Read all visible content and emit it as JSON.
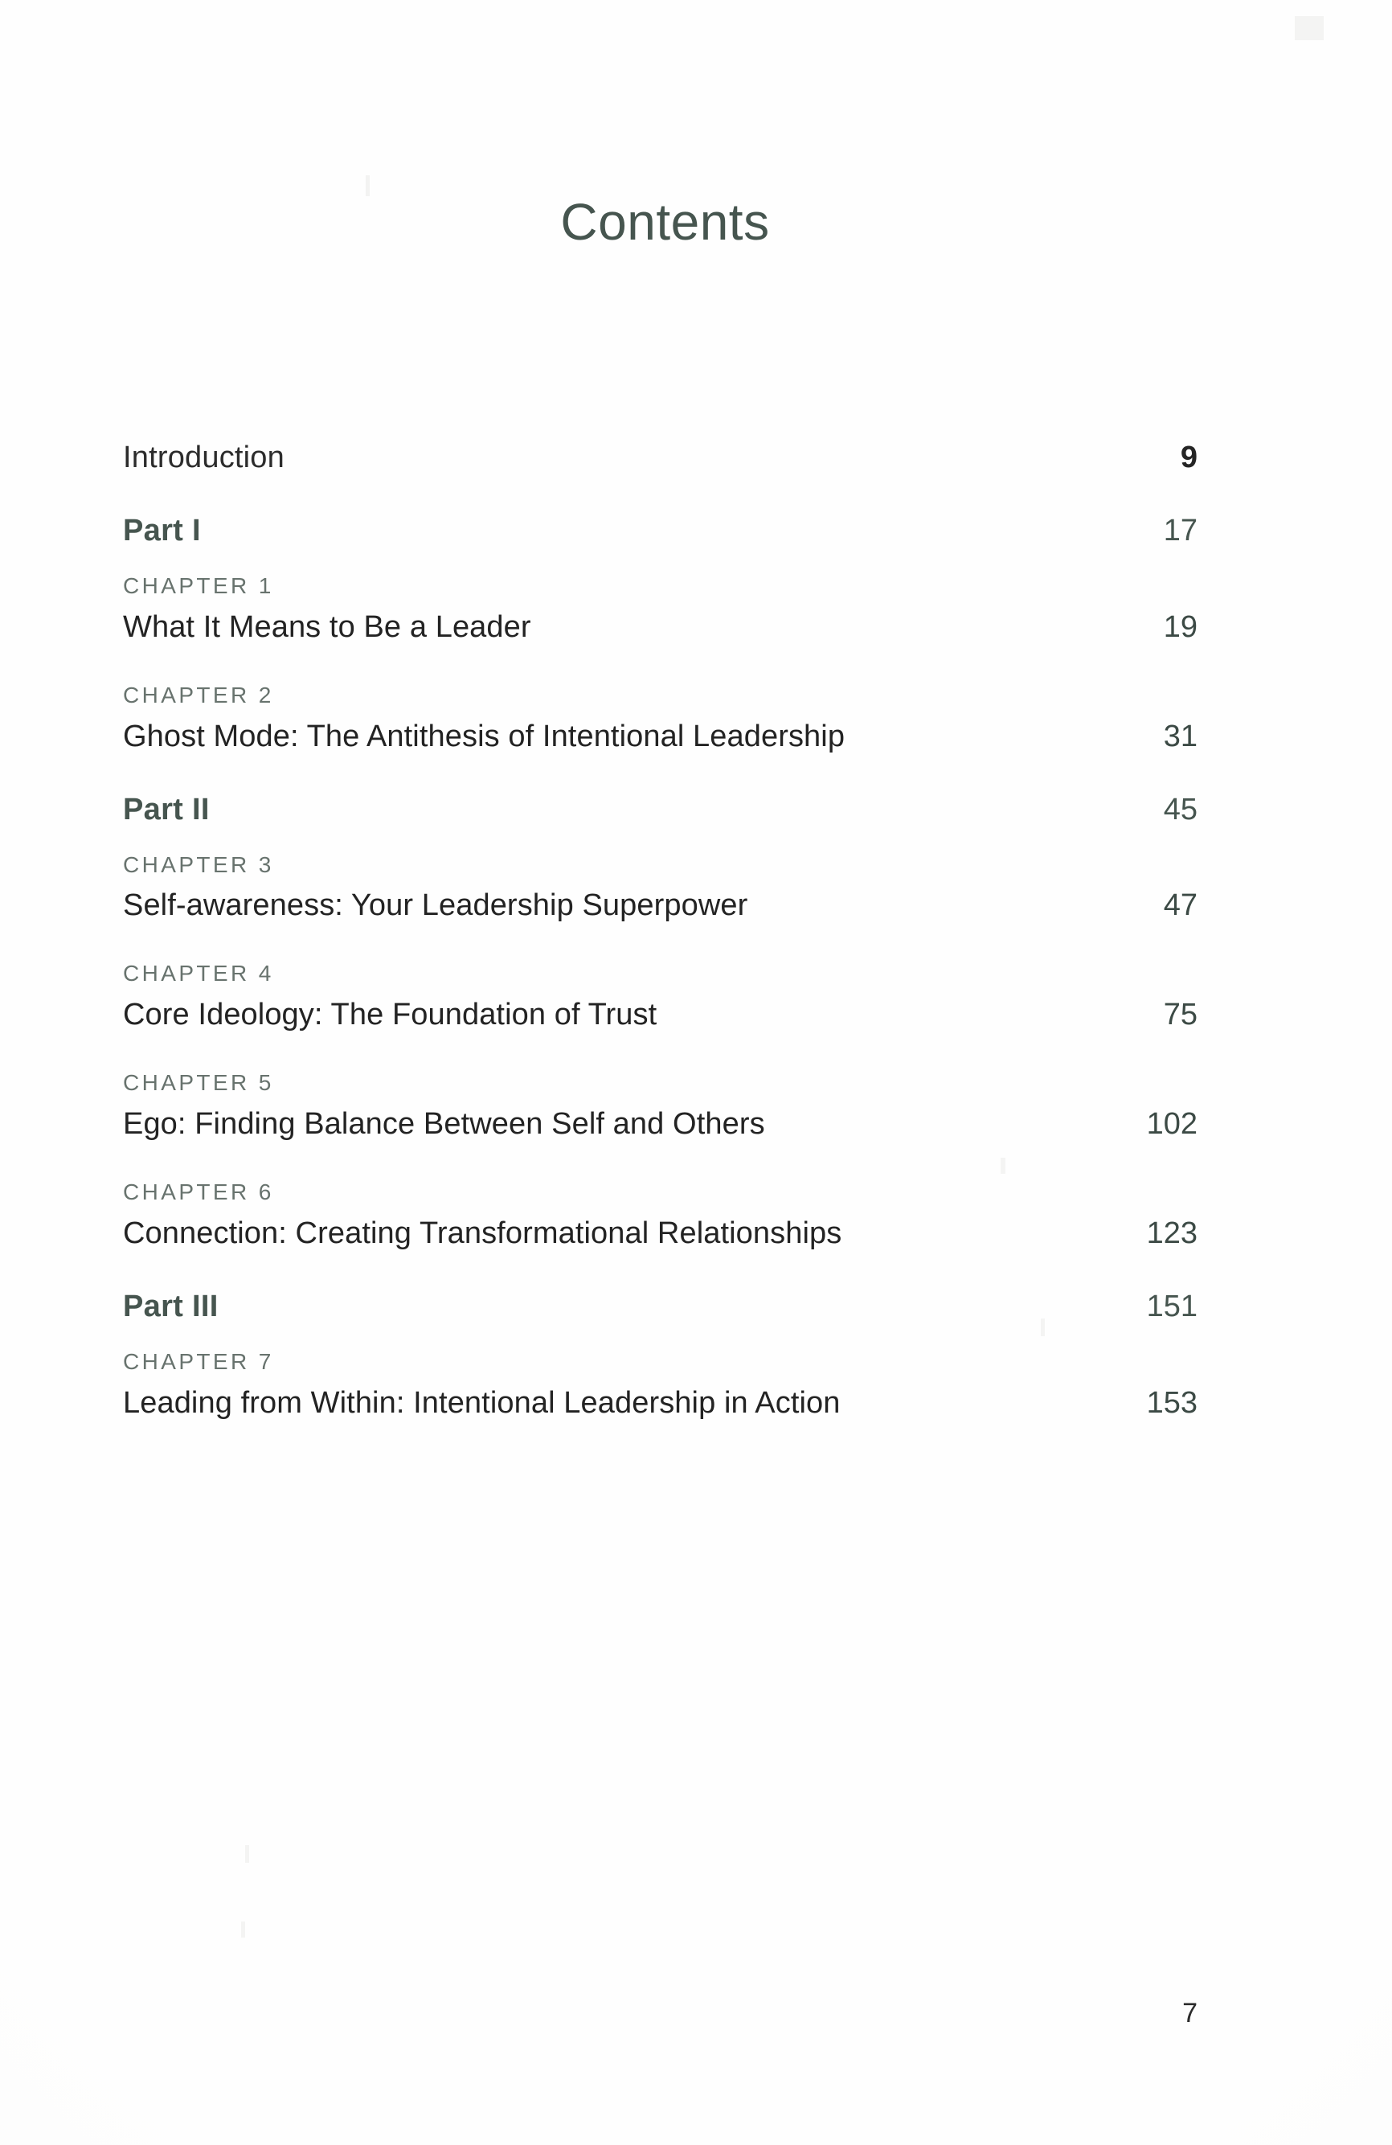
{
  "page": {
    "title": "Contents",
    "folio": "7"
  },
  "entries": [
    {
      "kind": "plain",
      "label": "Introduction",
      "page": "9"
    },
    {
      "kind": "part",
      "label": "Part I",
      "page": "17"
    },
    {
      "kind": "chapter",
      "kicker": "CHAPTER 1",
      "label": "What It Means to Be a Leader",
      "page": "19"
    },
    {
      "kind": "chapter",
      "kicker": "CHAPTER 2",
      "label": "Ghost Mode: The Antithesis of Intentional Leadership",
      "page": "31"
    },
    {
      "kind": "part",
      "label": "Part II",
      "page": "45"
    },
    {
      "kind": "chapter",
      "kicker": "CHAPTER 3",
      "label": "Self-awareness: Your Leadership Superpower",
      "page": "47"
    },
    {
      "kind": "chapter",
      "kicker": "CHAPTER 4",
      "label": "Core Ideology: The Foundation of Trust",
      "page": "75"
    },
    {
      "kind": "chapter",
      "kicker": "CHAPTER 5",
      "label": "Ego: Finding Balance Between Self and Others",
      "page": "102"
    },
    {
      "kind": "chapter",
      "kicker": "CHAPTER 6",
      "label": "Connection: Creating Transformational Relationships",
      "page": "123"
    },
    {
      "kind": "part",
      "label": "Part III",
      "page": "151"
    },
    {
      "kind": "chapter",
      "kicker": "CHAPTER 7",
      "label": "Leading from Within: Intentional Leadership in Action",
      "page": "153"
    }
  ],
  "colors": {
    "accent_green": "#46554f",
    "kicker_gray": "#68736e",
    "body_dark": "#232323",
    "paper": "#fefefe"
  }
}
